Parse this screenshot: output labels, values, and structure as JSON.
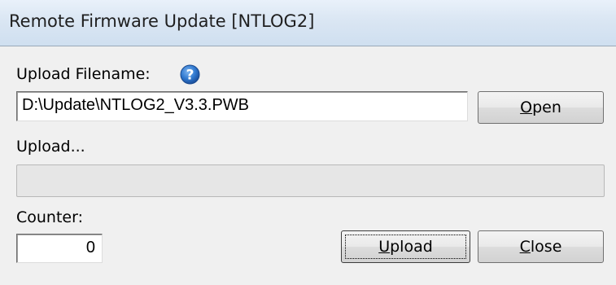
{
  "window": {
    "title": "Remote Firmware Update [NTLOG2]"
  },
  "upload_filename": {
    "label": "Upload Filename:",
    "value": "D:\\Update\\NTLOG2_V3.3.PWB",
    "help_icon": "help-icon"
  },
  "buttons": {
    "open": {
      "accel": "O",
      "rest": "pen"
    },
    "upload": {
      "accel": "U",
      "rest": "pload"
    },
    "close": {
      "accel": "C",
      "rest": "lose"
    }
  },
  "upload_status": {
    "label": "Upload...",
    "progress": 0
  },
  "counter": {
    "label": "Counter:",
    "value": "0"
  },
  "colors": {
    "titlebar": "#dae6f3",
    "dialog_background": "#f0f0f0",
    "help_icon_blue": "#2f78cf"
  }
}
